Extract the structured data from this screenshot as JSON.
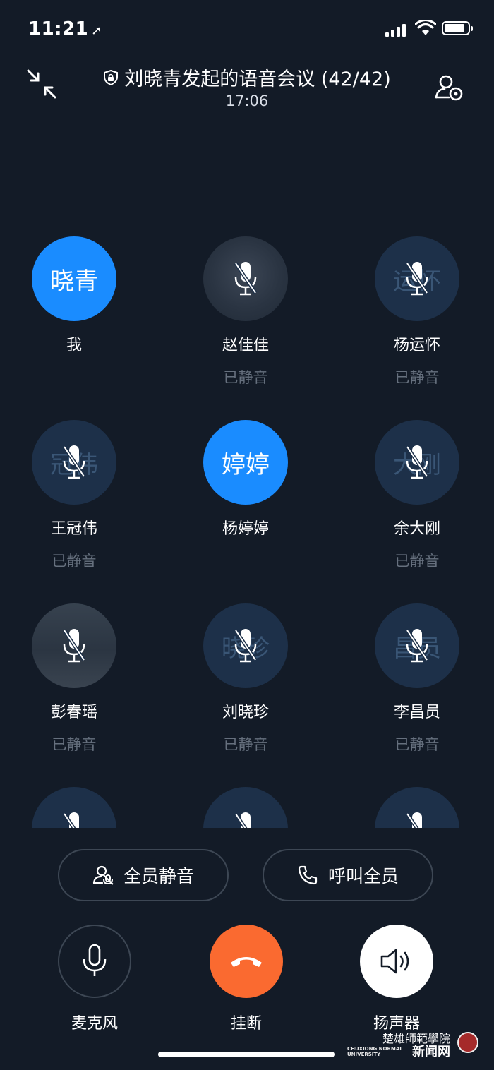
{
  "status_bar": {
    "time": "11:21"
  },
  "header": {
    "title": "刘晓青发起的语音会议 (42/42)",
    "duration": "17:06"
  },
  "participants": [
    {
      "avatar_text": "晓青",
      "name": "我",
      "status": "",
      "state": "active"
    },
    {
      "avatar_text": "",
      "name": "赵佳佳",
      "status": "已静音",
      "state": "muted-photo"
    },
    {
      "avatar_text": "运怀",
      "name": "杨运怀",
      "status": "已静音",
      "state": "muted"
    },
    {
      "avatar_text": "冠伟",
      "name": "王冠伟",
      "status": "已静音",
      "state": "muted"
    },
    {
      "avatar_text": "婷婷",
      "name": "杨婷婷",
      "status": "",
      "state": "active"
    },
    {
      "avatar_text": "大刚",
      "name": "余大刚",
      "status": "已静音",
      "state": "muted"
    },
    {
      "avatar_text": "",
      "name": "彭春瑶",
      "status": "已静音",
      "state": "muted-photo"
    },
    {
      "avatar_text": "晓珍",
      "name": "刘晓珍",
      "status": "已静音",
      "state": "muted"
    },
    {
      "avatar_text": "昌员",
      "name": "李昌员",
      "status": "已静音",
      "state": "muted"
    },
    {
      "avatar_text": "",
      "name": "",
      "status": "",
      "state": "muted"
    },
    {
      "avatar_text": "",
      "name": "",
      "status": "",
      "state": "muted"
    },
    {
      "avatar_text": "",
      "name": "",
      "status": "",
      "state": "muted"
    }
  ],
  "actions": {
    "mute_all": "全员静音",
    "call_all": "呼叫全员"
  },
  "controls": {
    "microphone": "麦克风",
    "hang_up": "挂断",
    "speaker": "扬声器"
  },
  "watermark": {
    "cn": "楚雄師範學院",
    "en": "CHUXIONG NORMAL UNIVERSITY",
    "news": "新闻网"
  },
  "colors": {
    "background": "#131b27",
    "accent": "#1a8cff",
    "hangup": "#fa6a30",
    "muted_text": "#66707e"
  }
}
